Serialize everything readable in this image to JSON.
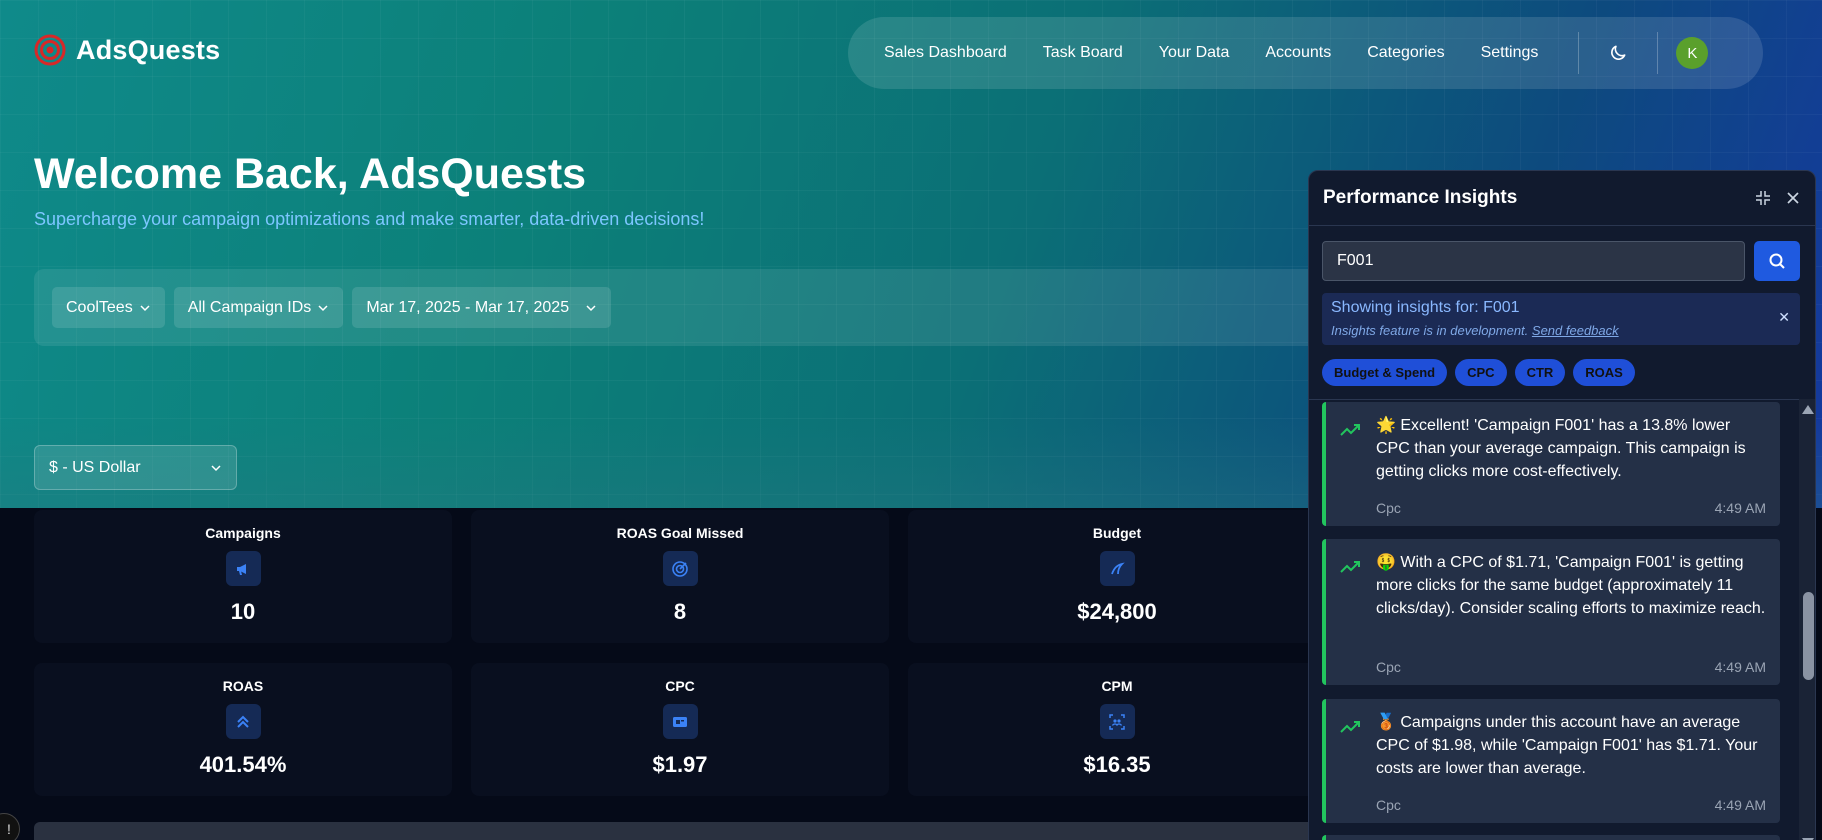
{
  "brand": {
    "name": "AdsQuests",
    "logo_icon": "target-logo-icon",
    "logo_color": "#d62828"
  },
  "nav": {
    "items": [
      "Sales Dashboard",
      "Task Board",
      "Your Data",
      "Accounts",
      "Categories",
      "Settings"
    ],
    "theme_icon": "moon-icon",
    "avatar_letter": "K",
    "avatar_color": "#5aa02c"
  },
  "hero": {
    "title": "Welcome Back, AdsQuests",
    "subtitle": "Supercharge your campaign optimizations and make smarter, data-driven decisions!"
  },
  "filters": {
    "account": "CoolTees",
    "campaign": "All Campaign IDs",
    "date_range": "Mar 17, 2025 - Mar 17, 2025"
  },
  "currency": {
    "selected": "$ - US Dollar"
  },
  "stats": [
    {
      "label": "Campaigns",
      "value": "10",
      "icon": "megaphone-icon"
    },
    {
      "label": "ROAS Goal Missed",
      "value": "8",
      "icon": "target-icon"
    },
    {
      "label": "Budget",
      "value": "$24,800",
      "icon": "money-icon"
    },
    {
      "label": "ROAS",
      "value": "401.54%",
      "icon": "chevrons-up-icon"
    },
    {
      "label": "CPC",
      "value": "$1.97",
      "icon": "bill-icon"
    },
    {
      "label": "CPM",
      "value": "$16.35",
      "icon": "scan-users-icon"
    }
  ],
  "panel": {
    "title": "Performance Insights",
    "search_value": "F001",
    "notice_title": "Showing insights for: F001",
    "notice_text": "Insights feature is in development.",
    "notice_link": "Send feedback",
    "chips": [
      "Budget & Spend",
      "CPC",
      "CTR",
      "ROAS"
    ],
    "accent": "#22c55e",
    "insights": [
      {
        "text": "🌟 Excellent! 'Campaign F001' has a 13.8% lower CPC than your average campaign. This campaign is getting clicks more cost-effectively.",
        "category": "Cpc",
        "time": "4:49 AM"
      },
      {
        "text": "🤑 With a CPC of $1.71, 'Campaign F001' is getting more clicks for the same budget (approximately 11 clicks/day). Consider scaling efforts to maximize reach.",
        "category": "Cpc",
        "time": "4:49 AM"
      },
      {
        "text": "🥉 Campaigns under this account have an average CPC of $1.98, while 'Campaign F001' has $1.71. Your costs are lower than average.",
        "category": "Cpc",
        "time": "4:49 AM"
      }
    ]
  }
}
